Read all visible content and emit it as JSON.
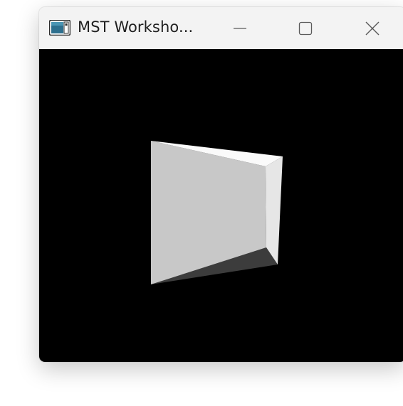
{
  "window": {
    "title": "MST Worksho...",
    "icon": "app-window-icon",
    "controls": {
      "minimize": "minimize-icon",
      "maximize": "maximize-icon",
      "close": "close-icon"
    }
  },
  "viewport": {
    "background": "#000000",
    "faces": {
      "front": "#c8c8c8",
      "top": "#fafafa",
      "right": "#e6e6e6",
      "bottom": "#3c3c3c"
    }
  }
}
